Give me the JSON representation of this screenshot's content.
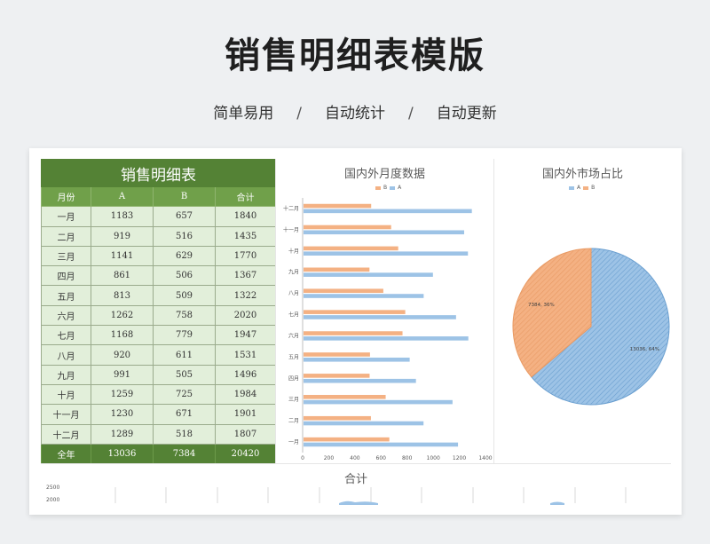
{
  "header": {
    "title": "销售明细表模版",
    "features": [
      "简单易用",
      "自动统计",
      "自动更新"
    ],
    "separator": "/"
  },
  "table": {
    "title": "销售明细表",
    "columns": [
      "月份",
      "A",
      "B",
      "合计"
    ],
    "rows": [
      [
        "一月",
        "1183",
        "657",
        "1840"
      ],
      [
        "二月",
        "919",
        "516",
        "1435"
      ],
      [
        "三月",
        "1141",
        "629",
        "1770"
      ],
      [
        "四月",
        "861",
        "506",
        "1367"
      ],
      [
        "五月",
        "813",
        "509",
        "1322"
      ],
      [
        "六月",
        "1262",
        "758",
        "2020"
      ],
      [
        "七月",
        "1168",
        "779",
        "1947"
      ],
      [
        "八月",
        "920",
        "611",
        "1531"
      ],
      [
        "九月",
        "991",
        "505",
        "1496"
      ],
      [
        "十月",
        "1259",
        "725",
        "1984"
      ],
      [
        "十一月",
        "1230",
        "671",
        "1901"
      ],
      [
        "十二月",
        "1289",
        "518",
        "1807"
      ]
    ],
    "total": [
      "全年",
      "13036",
      "7384",
      "20420"
    ]
  },
  "colors": {
    "A": "#9dc3e6",
    "B": "#f4b183",
    "A_edge": "#6a9fd0",
    "B_edge": "#e99a63",
    "green_dark": "#548235",
    "green_mid": "#70a04a",
    "green_light": "#e2efda"
  },
  "chart_data": [
    {
      "type": "bar",
      "orientation": "horizontal",
      "title": "国内外月度数据",
      "categories": [
        "一月",
        "二月",
        "三月",
        "四月",
        "五月",
        "六月",
        "七月",
        "八月",
        "九月",
        "十月",
        "十一月",
        "十二月"
      ],
      "series": [
        {
          "name": "A",
          "values": [
            1183,
            919,
            1141,
            861,
            813,
            1262,
            1168,
            920,
            991,
            1259,
            1230,
            1289
          ]
        },
        {
          "name": "B",
          "values": [
            657,
            516,
            629,
            506,
            509,
            758,
            779,
            611,
            505,
            725,
            671,
            518
          ]
        }
      ],
      "legend": [
        "B",
        "A"
      ],
      "xlim": [
        0,
        1400
      ],
      "xticks": [
        "0",
        "200",
        "400",
        "600",
        "800",
        "1000",
        "1200",
        "1400"
      ],
      "legend_position": "top"
    },
    {
      "type": "pie",
      "title": "国内外市场占比",
      "labels": [
        "A",
        "B"
      ],
      "values": [
        13036,
        7384
      ],
      "data_labels": [
        "13036, 64%",
        "7384, 36%"
      ],
      "legend": [
        "A",
        "B"
      ],
      "legend_position": "top"
    },
    {
      "type": "line",
      "title": "合计",
      "yticks": [
        "2500",
        "2000"
      ]
    }
  ]
}
